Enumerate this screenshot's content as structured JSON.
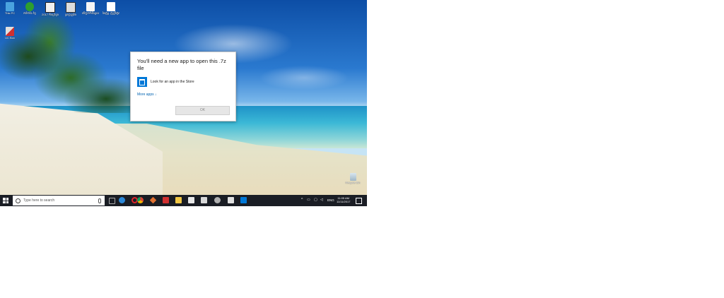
{
  "desktop": {
    "icons": [
      {
        "label": "This PC",
        "icon": "computer-icon",
        "color": "#4aa3df"
      },
      {
        "label": "ობობა ხე",
        "icon": "tree-icon",
        "color": "#2e9e2e"
      },
      {
        "label": "2017 რიცხვი",
        "icon": "document-icon",
        "color": "#f0f0f0"
      },
      {
        "label": "ყიდვები",
        "icon": "document-icon",
        "color": "#dddddd"
      },
      {
        "label": "ინფორმაცია...",
        "icon": "file-icon",
        "color": "#f5f5f5"
      },
      {
        "label": "სიტყ. ტექსტი",
        "icon": "file-icon",
        "color": "#ffffff"
      },
      {
        "label": "UC Box",
        "icon": "app-icon",
        "color": "#d03030"
      }
    ],
    "recycle_bin_label": "Recycle Bin"
  },
  "dialog": {
    "title": "You'll need a new app to open this .7z file",
    "store_option": "Look for an app in the Store",
    "more_apps": "More apps ↓",
    "ok_label": "OK"
  },
  "taskbar": {
    "search_placeholder": "Type here to search",
    "pinned": [
      {
        "icon": "task-view-icon",
        "color": "#3a3d44"
      },
      {
        "icon": "edge-icon",
        "color": "#2b88d8"
      },
      {
        "icon": "opera-icon",
        "color": "#e0242b"
      },
      {
        "icon": "chrome-icon",
        "color": "#e0a020"
      },
      {
        "icon": "app-icon",
        "color": "#e07030"
      },
      {
        "icon": "app-icon",
        "color": "#d03030"
      },
      {
        "icon": "file-explorer-icon",
        "color": "#f2c744"
      },
      {
        "icon": "store-icon",
        "color": "#e8e8e8"
      },
      {
        "icon": "app-icon",
        "color": "#d8d8d8"
      },
      {
        "icon": "app-icon",
        "color": "#b0b0b0"
      },
      {
        "icon": "calculator-icon",
        "color": "#e0e0e0"
      },
      {
        "icon": "app-icon",
        "color": "#0078d7"
      }
    ],
    "tray": {
      "language": "ENG",
      "time": "11:05 AM",
      "date": "11/11/2017"
    }
  }
}
